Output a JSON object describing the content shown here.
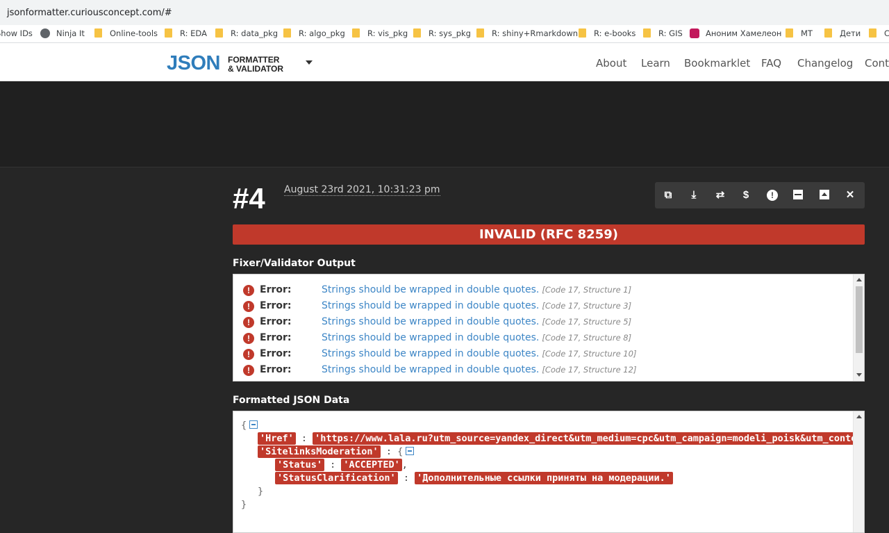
{
  "browser": {
    "url": "jsonformatter.curiousconcept.com/#",
    "bookmarks": [
      "Show IDs",
      "Ninja It",
      "Online-tools",
      "R: EDA",
      "R: data_pkg",
      "R: algo_pkg",
      "R: vis_pkg",
      "R: sys_pkg",
      "R: shiny+Rmarkdown",
      "R: e-books",
      "R: GIS",
      "Аноним Хамелеон",
      "MT",
      "Дети",
      "C"
    ]
  },
  "header": {
    "logo_main": "JSON",
    "logo_line1": "FORMATTER",
    "logo_line2": "& VALIDATOR",
    "nav": [
      "About",
      "Learn",
      "Bookmarklet",
      "FAQ",
      "Changelog",
      "Cont"
    ]
  },
  "result": {
    "number": "#4",
    "date": "August 23rd 2021, 10:31:23 pm",
    "toolbar_icons": [
      "copy-icon",
      "download-icon",
      "refresh-icon",
      "dollar-icon",
      "info-icon",
      "minimize-icon",
      "collapse-up-icon",
      "close-icon"
    ],
    "status": "INVALID (RFC 8259)",
    "accent_color": "#c0392b"
  },
  "validator": {
    "title": "Fixer/Validator Output",
    "errors": [
      {
        "label": "Error:",
        "message": "Strings should be wrapped in double quotes.",
        "code": "[Code 17, Structure 1]"
      },
      {
        "label": "Error:",
        "message": "Strings should be wrapped in double quotes.",
        "code": "[Code 17, Structure 3]"
      },
      {
        "label": "Error:",
        "message": "Strings should be wrapped in double quotes.",
        "code": "[Code 17, Structure 5]"
      },
      {
        "label": "Error:",
        "message": "Strings should be wrapped in double quotes.",
        "code": "[Code 17, Structure 8]"
      },
      {
        "label": "Error:",
        "message": "Strings should be wrapped in double quotes.",
        "code": "[Code 17, Structure 10]"
      },
      {
        "label": "Error:",
        "message": "Strings should be wrapped in double quotes.",
        "code": "[Code 17, Structure 12]"
      }
    ]
  },
  "formatted": {
    "title": "Formatted JSON Data",
    "open_brace": "{",
    "close_brace": "}",
    "href_key": "'Href'",
    "href_value": "'https://www.lala.ru?utm_source=yandex_direct&utm_medium=cpc&utm_campaign=modeli_poisk&utm_conte",
    "sitelinks_key": "'SitelinksModeration'",
    "status_key": "'Status'",
    "status_value": "'ACCEPTED'",
    "clar_key": "'StatusClarification'",
    "clar_value": "'Дополнительные ссылки приняты на модерации.'"
  }
}
